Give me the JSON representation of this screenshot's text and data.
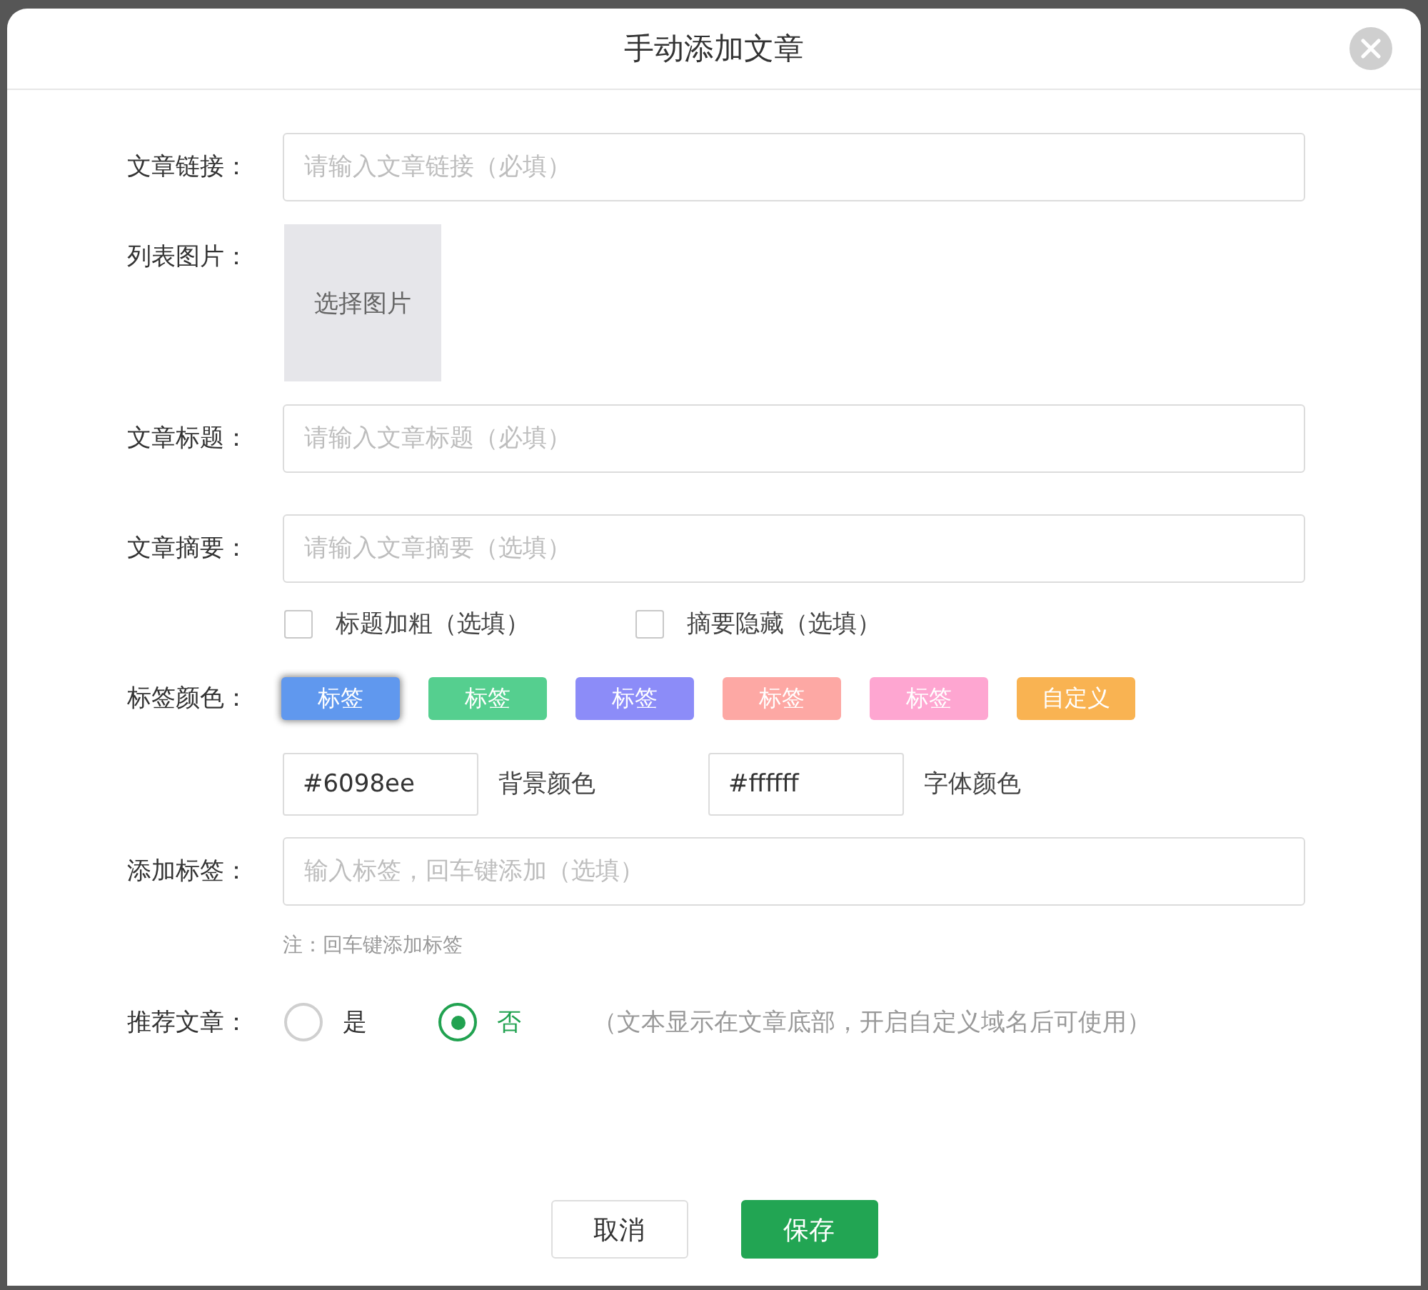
{
  "dialog": {
    "title": "手动添加文章"
  },
  "fields": [
    {
      "kind": "text",
      "label": "文章链接：",
      "placeholder": "请输入文章链接（必填）"
    },
    {
      "kind": "image",
      "label": "列表图片：",
      "button": "选择图片"
    },
    {
      "kind": "text",
      "label": "文章标题：",
      "placeholder": "请输入文章标题（必填）"
    },
    {
      "kind": "text",
      "label": "文章摘要：",
      "placeholder": "请输入文章摘要（选填）"
    },
    {
      "kind": "checkboxes",
      "options": [
        {
          "label": "标题加粗（选填）",
          "checked": false
        },
        {
          "label": "摘要隐藏（选填）",
          "checked": false
        }
      ]
    },
    {
      "kind": "tag_colors",
      "label": "标签颜色：",
      "swatches": [
        {
          "label": "标签",
          "color": "#6098ee",
          "selected": true
        },
        {
          "label": "标签",
          "color": "#55cf8f",
          "selected": false
        },
        {
          "label": "标签",
          "color": "#8c8cf8",
          "selected": false
        },
        {
          "label": "标签",
          "color": "#fda8a4",
          "selected": false
        },
        {
          "label": "标签",
          "color": "#fea6d1",
          "selected": false
        },
        {
          "label": "自定义",
          "color": "#f9b352",
          "selected": false
        }
      ],
      "inputs": [
        {
          "value": "#6098ee",
          "caption_after": "背景颜色"
        },
        {
          "value": "#ffffff",
          "caption_after": "字体颜色"
        }
      ]
    },
    {
      "kind": "text",
      "label": "添加标签：",
      "placeholder": "输入标签，回车键添加（选填）",
      "note": "注：回车键添加标签"
    },
    {
      "kind": "radio",
      "label": "推荐文章：",
      "options": [
        {
          "label": "是",
          "selected": false
        },
        {
          "label": "否",
          "selected": true
        }
      ],
      "hint": "（文本显示在文章底部，开启自定义域名后可使用）"
    }
  ],
  "buttons": [
    {
      "label": "取消",
      "kind": "secondary"
    },
    {
      "label": "保存",
      "kind": "primary"
    }
  ]
}
